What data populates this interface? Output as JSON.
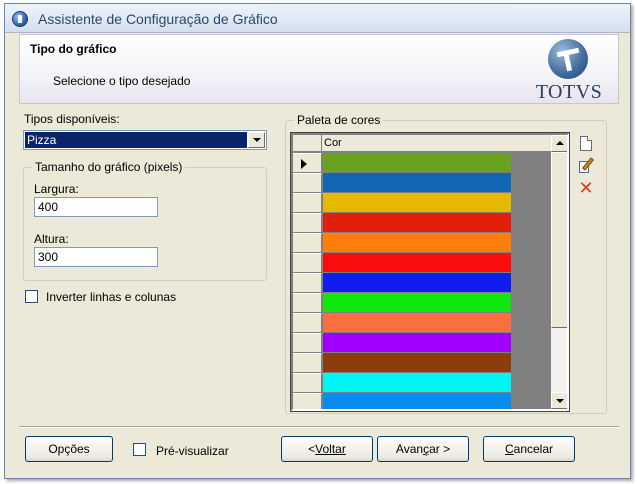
{
  "window": {
    "title": "Assistente de Configuração de Gráfico"
  },
  "header": {
    "title": "Tipo do gráfico",
    "subtitle": "Selecione o tipo desejado",
    "logo_text": "TOTVS"
  },
  "chart_types": {
    "label": "Tipos disponíveis:",
    "selected": "Pizza"
  },
  "size_group": {
    "legend": "Tamanho do gráfico (pixels)",
    "width_label": "Largura:",
    "width_value": "400",
    "height_label": "Altura:",
    "height_value": "300"
  },
  "invert_checkbox": {
    "label": "Inverter linhas e colunas",
    "checked": false
  },
  "palette": {
    "legend": "Paleta de cores",
    "column_header": "Cor",
    "colors": [
      "#6aa121",
      "#1166b5",
      "#e7b800",
      "#e11f0a",
      "#ff7e0a",
      "#fb0d0d",
      "#0f1df0",
      "#0fe70f",
      "#fa6f42",
      "#a100ff",
      "#8b3e0b",
      "#00f5f5",
      "#0a8ced"
    ],
    "selected_row": 0,
    "tools": {
      "new_icon": "new-document-icon",
      "edit_icon": "edit-icon",
      "delete_icon": "delete-icon"
    }
  },
  "footer": {
    "options_label": "Opções",
    "preview_label": "Pré-visualizar",
    "preview_checked": false,
    "back_prefix": "< ",
    "back_label": "Voltar",
    "next_prefix": "Avan",
    "next_accel": "ç",
    "next_suffix": "ar >",
    "cancel_accel": "C",
    "cancel_rest": "ancelar"
  }
}
